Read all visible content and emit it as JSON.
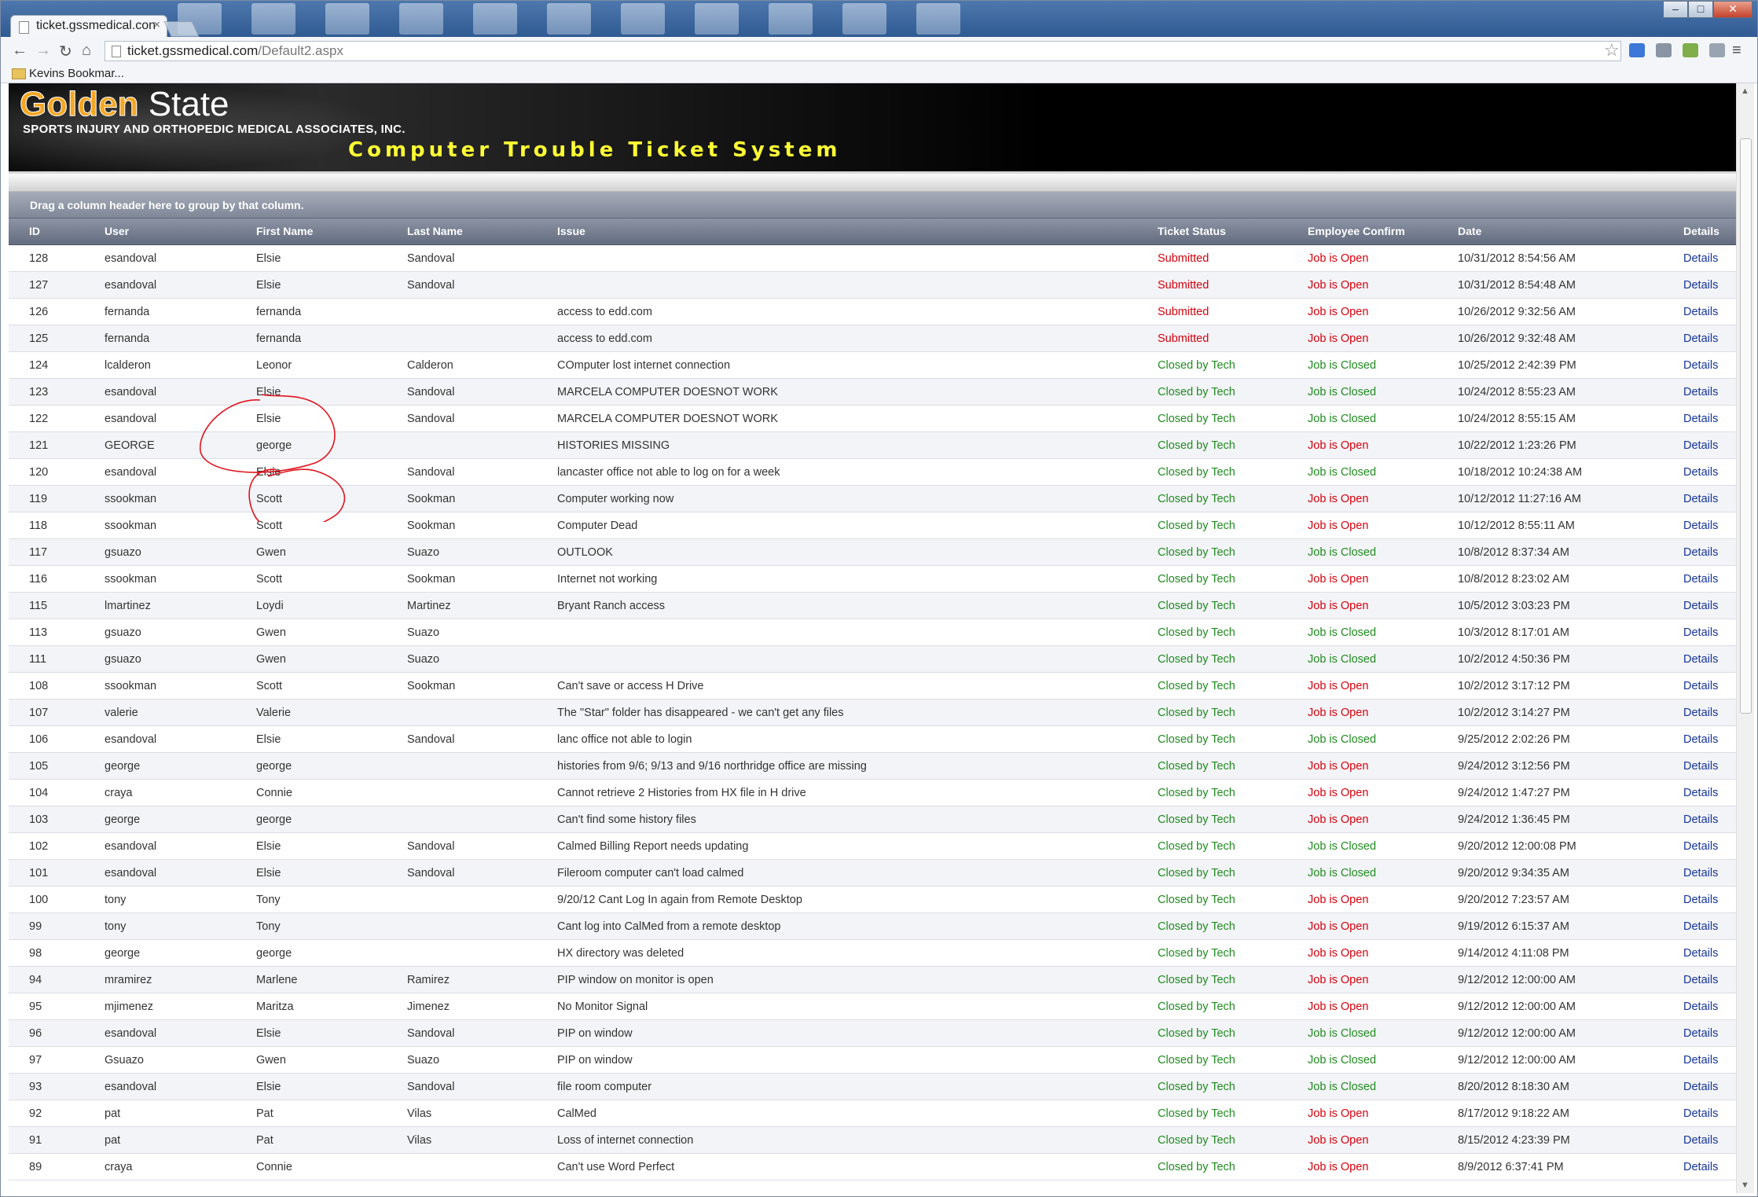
{
  "browser": {
    "tab_title": "ticket.gssmedical.con",
    "tab_close": "×",
    "url_host": "ticket.gssmedical.com",
    "url_path": "/Default2.aspx",
    "bookmark": "Kevins Bookmar...",
    "icons": [
      "back-icon",
      "forward-icon",
      "reload-icon",
      "home-icon",
      "star-icon",
      "menu-icon"
    ]
  },
  "header": {
    "logo_part1": "Golden",
    "logo_part2": " State",
    "company": "SPORTS INJURY AND ORTHOPEDIC MEDICAL ASSOCIATES, INC.",
    "system_title": "Computer Trouble Ticket System"
  },
  "grid": {
    "group_hint": "Drag a column header here to group by that column.",
    "columns": {
      "id": "ID",
      "user": "User",
      "first": "First Name",
      "last": "Last Name",
      "issue": "Issue",
      "status": "Ticket Status",
      "confirm": "Employee Confirm",
      "date": "Date",
      "details": "Details"
    },
    "rows": [
      {
        "id": "128",
        "user": "esandoval",
        "first": "Elsie",
        "last": "Sandoval",
        "issue": "",
        "status": "Submitted",
        "confirm": "Job is Open",
        "date": "10/31/2012 8:54:56 AM",
        "details": "Details"
      },
      {
        "id": "127",
        "user": "esandoval",
        "first": "Elsie",
        "last": "Sandoval",
        "issue": "",
        "status": "Submitted",
        "confirm": "Job is Open",
        "date": "10/31/2012 8:54:48 AM",
        "details": "Details"
      },
      {
        "id": "126",
        "user": "fernanda",
        "first": "fernanda",
        "last": "",
        "issue": "access to edd.com",
        "status": "Submitted",
        "confirm": "Job is Open",
        "date": "10/26/2012 9:32:56 AM",
        "details": "Details"
      },
      {
        "id": "125",
        "user": "fernanda",
        "first": "fernanda",
        "last": "",
        "issue": "access to edd.com",
        "status": "Submitted",
        "confirm": "Job is Open",
        "date": "10/26/2012 9:32:48 AM",
        "details": "Details"
      },
      {
        "id": "124",
        "user": "lcalderon",
        "first": "Leonor",
        "last": "Calderon",
        "issue": "COmputer lost internet connection",
        "status": "Closed by Tech",
        "confirm": "Job is Closed",
        "date": "10/25/2012 2:42:39 PM",
        "details": "Details"
      },
      {
        "id": "123",
        "user": "esandoval",
        "first": "Elsie",
        "last": "Sandoval",
        "issue": "MARCELA COMPUTER DOESNOT WORK",
        "status": "Closed by Tech",
        "confirm": "Job is Closed",
        "date": "10/24/2012 8:55:23 AM",
        "details": "Details"
      },
      {
        "id": "122",
        "user": "esandoval",
        "first": "Elsie",
        "last": "Sandoval",
        "issue": "MARCELA COMPUTER DOESNOT WORK",
        "status": "Closed by Tech",
        "confirm": "Job is Closed",
        "date": "10/24/2012 8:55:15 AM",
        "details": "Details"
      },
      {
        "id": "121",
        "user": "GEORGE",
        "first": "george",
        "last": "",
        "issue": "HISTORIES MISSING",
        "status": "Closed by Tech",
        "confirm": "Job is Open",
        "date": "10/22/2012 1:23:26 PM",
        "details": "Details"
      },
      {
        "id": "120",
        "user": "esandoval",
        "first": "Elsie",
        "last": "Sandoval",
        "issue": "lancaster office not able to log on for a week",
        "status": "Closed by Tech",
        "confirm": "Job is Closed",
        "date": "10/18/2012 10:24:38 AM",
        "details": "Details"
      },
      {
        "id": "119",
        "user": "ssookman",
        "first": "Scott",
        "last": "Sookman",
        "issue": "Computer working now",
        "status": "Closed by Tech",
        "confirm": "Job is Open",
        "date": "10/12/2012 11:27:16 AM",
        "details": "Details"
      },
      {
        "id": "118",
        "user": "ssookman",
        "first": "Scott",
        "last": "Sookman",
        "issue": "Computer Dead",
        "status": "Closed by Tech",
        "confirm": "Job is Open",
        "date": "10/12/2012 8:55:11 AM",
        "details": "Details"
      },
      {
        "id": "117",
        "user": "gsuazo",
        "first": "Gwen",
        "last": "Suazo",
        "issue": "OUTLOOK",
        "status": "Closed by Tech",
        "confirm": "Job is Closed",
        "date": "10/8/2012 8:37:34 AM",
        "details": "Details"
      },
      {
        "id": "116",
        "user": "ssookman",
        "first": "Scott",
        "last": "Sookman",
        "issue": "Internet not working",
        "status": "Closed by Tech",
        "confirm": "Job is Open",
        "date": "10/8/2012 8:23:02 AM",
        "details": "Details"
      },
      {
        "id": "115",
        "user": "lmartinez",
        "first": "Loydi",
        "last": "Martinez",
        "issue": "Bryant Ranch access",
        "status": "Closed by Tech",
        "confirm": "Job is Open",
        "date": "10/5/2012 3:03:23 PM",
        "details": "Details"
      },
      {
        "id": "113",
        "user": "gsuazo",
        "first": "Gwen",
        "last": "Suazo",
        "issue": "",
        "status": "Closed by Tech",
        "confirm": "Job is Closed",
        "date": "10/3/2012 8:17:01 AM",
        "details": "Details"
      },
      {
        "id": "111",
        "user": "gsuazo",
        "first": "Gwen",
        "last": "Suazo",
        "issue": "",
        "status": "Closed by Tech",
        "confirm": "Job is Closed",
        "date": "10/2/2012 4:50:36 PM",
        "details": "Details"
      },
      {
        "id": "108",
        "user": "ssookman",
        "first": "Scott",
        "last": "Sookman",
        "issue": "Can't save  or access H Drive",
        "status": "Closed by Tech",
        "confirm": "Job is Open",
        "date": "10/2/2012 3:17:12 PM",
        "details": "Details"
      },
      {
        "id": "107",
        "user": "valerie",
        "first": "Valerie",
        "last": "",
        "issue": "The \"Star\" folder has disappeared - we can't get any files",
        "status": "Closed by Tech",
        "confirm": "Job is Open",
        "date": "10/2/2012 3:14:27 PM",
        "details": "Details"
      },
      {
        "id": "106",
        "user": "esandoval",
        "first": "Elsie",
        "last": "Sandoval",
        "issue": "lanc office not able to login",
        "status": "Closed by Tech",
        "confirm": "Job is Closed",
        "date": "9/25/2012 2:02:26 PM",
        "details": "Details"
      },
      {
        "id": "105",
        "user": "george",
        "first": "george",
        "last": "",
        "issue": "histories from 9/6; 9/13 and 9/16 northridge office are missing",
        "status": "Closed by Tech",
        "confirm": "Job is Open",
        "date": "9/24/2012 3:12:56 PM",
        "details": "Details"
      },
      {
        "id": "104",
        "user": "craya",
        "first": "Connie",
        "last": "",
        "issue": "Cannot retrieve 2 Histories from HX file in H drive",
        "status": "Closed by Tech",
        "confirm": "Job is Open",
        "date": "9/24/2012 1:47:27 PM",
        "details": "Details"
      },
      {
        "id": "103",
        "user": "george",
        "first": "george",
        "last": "",
        "issue": "Can't find some history files",
        "status": "Closed by Tech",
        "confirm": "Job is Open",
        "date": "9/24/2012 1:36:45 PM",
        "details": "Details"
      },
      {
        "id": "102",
        "user": "esandoval",
        "first": "Elsie",
        "last": "Sandoval",
        "issue": "Calmed Billing Report needs updating",
        "status": "Closed by Tech",
        "confirm": "Job is Closed",
        "date": "9/20/2012 12:00:08 PM",
        "details": "Details"
      },
      {
        "id": "101",
        "user": "esandoval",
        "first": "Elsie",
        "last": "Sandoval",
        "issue": "Fileroom computer can't load calmed",
        "status": "Closed by Tech",
        "confirm": "Job is Closed",
        "date": "9/20/2012 9:34:35 AM",
        "details": "Details"
      },
      {
        "id": "100",
        "user": "tony",
        "first": "Tony",
        "last": "",
        "issue": "9/20/12 Cant Log In again from Remote Desktop",
        "status": "Closed by Tech",
        "confirm": "Job is Open",
        "date": "9/20/2012 7:23:57 AM",
        "details": "Details"
      },
      {
        "id": "99",
        "user": "tony",
        "first": "Tony",
        "last": "",
        "issue": "Cant log into CalMed from a remote desktop",
        "status": "Closed by Tech",
        "confirm": "Job is Open",
        "date": "9/19/2012 6:15:37 AM",
        "details": "Details"
      },
      {
        "id": "98",
        "user": "george",
        "first": "george",
        "last": "",
        "issue": "HX directory was deleted",
        "status": "Closed by Tech",
        "confirm": "Job is Open",
        "date": "9/14/2012 4:11:08 PM",
        "details": "Details"
      },
      {
        "id": "94",
        "user": "mramirez",
        "first": "Marlene",
        "last": "Ramirez",
        "issue": "PIP window on monitor is open",
        "status": "Closed by Tech",
        "confirm": "Job is Open",
        "date": "9/12/2012 12:00:00 AM",
        "details": "Details"
      },
      {
        "id": "95",
        "user": "mjimenez",
        "first": "Maritza",
        "last": "Jimenez",
        "issue": "No Monitor Signal",
        "status": "Closed by Tech",
        "confirm": "Job is Open",
        "date": "9/12/2012 12:00:00 AM",
        "details": "Details"
      },
      {
        "id": "96",
        "user": "esandoval",
        "first": "Elsie",
        "last": "Sandoval",
        "issue": "PIP on window",
        "status": "Closed by Tech",
        "confirm": "Job is Closed",
        "date": "9/12/2012 12:00:00 AM",
        "details": "Details"
      },
      {
        "id": "97",
        "user": "Gsuazo",
        "first": "Gwen",
        "last": "Suazo",
        "issue": "PIP on window",
        "status": "Closed by Tech",
        "confirm": "Job is Closed",
        "date": "9/12/2012 12:00:00 AM",
        "details": "Details"
      },
      {
        "id": "93",
        "user": "esandoval",
        "first": "Elsie",
        "last": "Sandoval",
        "issue": "file room computer",
        "status": "Closed by Tech",
        "confirm": "Job is Closed",
        "date": "8/20/2012 8:18:30 AM",
        "details": "Details"
      },
      {
        "id": "92",
        "user": "pat",
        "first": "Pat",
        "last": "Vilas",
        "issue": "CalMed",
        "status": "Closed by Tech",
        "confirm": "Job is Open",
        "date": "8/17/2012 9:18:22 AM",
        "details": "Details"
      },
      {
        "id": "91",
        "user": "pat",
        "first": "Pat",
        "last": "Vilas",
        "issue": "Loss of internet connection",
        "status": "Closed by Tech",
        "confirm": "Job is Open",
        "date": "8/15/2012 4:23:39 PM",
        "details": "Details"
      },
      {
        "id": "89",
        "user": "craya",
        "first": "Connie",
        "last": "",
        "issue": "Can't use Word Perfect",
        "status": "Closed by Tech",
        "confirm": "Job is Open",
        "date": "8/9/2012 6:37:41 PM",
        "details": "Details"
      }
    ]
  },
  "colors": {
    "submitted": "#d8000c",
    "closed_by_tech": "#1f8c1f",
    "job_open": "#d8000c",
    "job_closed": "#1f8c1f",
    "details_link": "#15359a",
    "annotation": "#e0141e"
  }
}
